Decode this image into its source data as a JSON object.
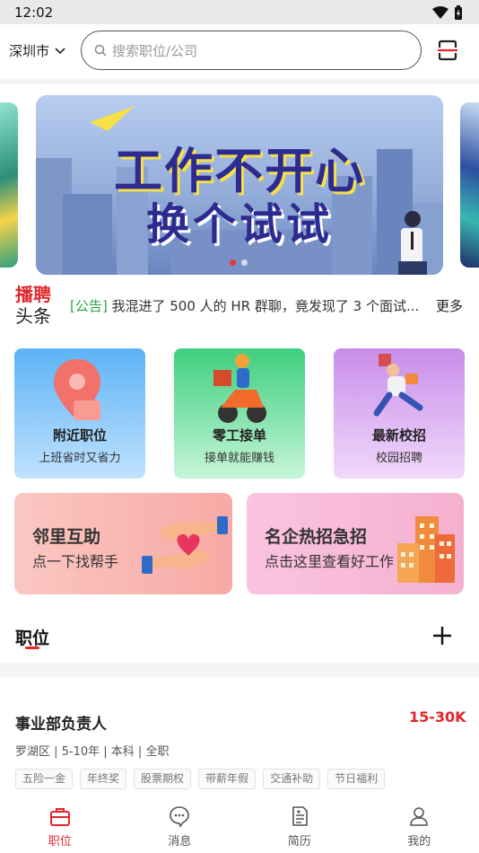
{
  "status": {
    "time": "12:02"
  },
  "header": {
    "city": "深圳市",
    "search_placeholder": "搜索职位/公司"
  },
  "banner": {
    "line1": "工作不开心",
    "line2": "换个试试"
  },
  "news": {
    "logo_top": "播聘",
    "logo_bottom": "头条",
    "tag": "[公告]",
    "text": "我混进了 500 人的 HR 群聊，竟发现了 3 个面试...",
    "more": "更多"
  },
  "shortcuts": [
    {
      "title": "附近职位",
      "subtitle": "上班省时又省力",
      "icon": "location-pin-icon"
    },
    {
      "title": "零工接单",
      "subtitle": "接单就能赚钱",
      "icon": "scooter-rider-icon"
    },
    {
      "title": "最新校招",
      "subtitle": "校园招聘",
      "icon": "graduate-icon"
    }
  ],
  "promos": [
    {
      "title": "邻里互助",
      "subtitle": "点一下找帮手",
      "icon": "helping-hands-icon"
    },
    {
      "title": "名企热招急招",
      "subtitle": "点击这里查看好工作",
      "icon": "buildings-icon"
    }
  ],
  "section": {
    "title": "职位"
  },
  "job": {
    "title": "事业部负责人",
    "salary": "15-30K",
    "meta": "罗湖区 | 5-10年 | 本科 | 全职",
    "tags": [
      "五险一金",
      "年终奖",
      "股票期权",
      "带薪年假",
      "交通补助",
      "节日福利"
    ]
  },
  "tabs": [
    {
      "label": "职位",
      "icon": "briefcase-icon",
      "active": true
    },
    {
      "label": "消息",
      "icon": "chat-icon",
      "active": false
    },
    {
      "label": "简历",
      "icon": "resume-icon",
      "active": false
    },
    {
      "label": "我的",
      "icon": "profile-icon",
      "active": false
    }
  ],
  "colors": {
    "accent": "#e0272b",
    "tag_green": "#29a745"
  }
}
